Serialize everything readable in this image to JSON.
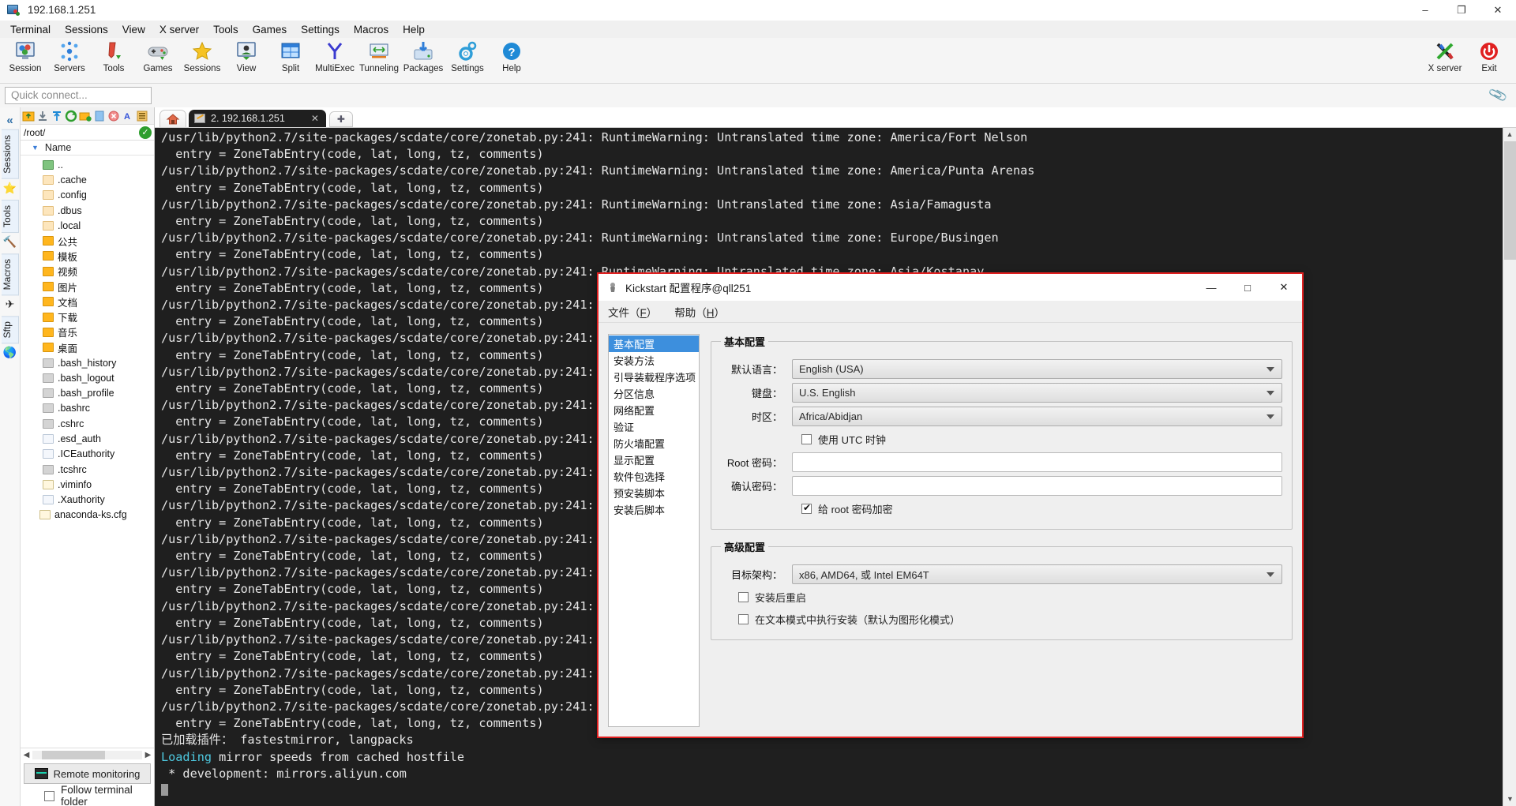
{
  "window": {
    "title": "192.168.1.251",
    "icon": "mobaxterm-icon",
    "minimize": "–",
    "maximize": "❐",
    "close": "✕"
  },
  "menubar": [
    "Terminal",
    "Sessions",
    "View",
    "X server",
    "Tools",
    "Games",
    "Settings",
    "Macros",
    "Help"
  ],
  "toolbar": {
    "items": [
      {
        "label": "Session",
        "icon": "session-icon"
      },
      {
        "label": "Servers",
        "icon": "servers-icon"
      },
      {
        "label": "Tools",
        "icon": "tools-icon"
      },
      {
        "label": "Games",
        "icon": "games-icon"
      },
      {
        "label": "Sessions",
        "icon": "star-icon"
      },
      {
        "label": "View",
        "icon": "view-icon"
      },
      {
        "label": "Split",
        "icon": "split-icon"
      },
      {
        "label": "MultiExec",
        "icon": "multiexec-icon"
      },
      {
        "label": "Tunneling",
        "icon": "tunneling-icon"
      },
      {
        "label": "Packages",
        "icon": "packages-icon"
      },
      {
        "label": "Settings",
        "icon": "settings-gear-icon"
      },
      {
        "label": "Help",
        "icon": "help-icon"
      }
    ],
    "right": [
      {
        "label": "X server",
        "icon": "x-server-icon"
      },
      {
        "label": "Exit",
        "icon": "power-icon"
      }
    ]
  },
  "quick_connect": {
    "placeholder": "Quick connect...",
    "value": ""
  },
  "sidebar": {
    "collapse": "«",
    "vtabs": [
      "Sessions",
      "Tools",
      "Macros",
      "Sftp"
    ],
    "path": "/root/",
    "tree_header": "Name",
    "items": [
      {
        "name": "..",
        "type": "up"
      },
      {
        "name": ".cache",
        "type": "folder-light"
      },
      {
        "name": ".config",
        "type": "folder-light"
      },
      {
        "name": ".dbus",
        "type": "folder-light"
      },
      {
        "name": ".local",
        "type": "folder-light"
      },
      {
        "name": "公共",
        "type": "folder"
      },
      {
        "name": "模板",
        "type": "folder"
      },
      {
        "name": "视频",
        "type": "folder"
      },
      {
        "name": "图片",
        "type": "folder"
      },
      {
        "name": "文档",
        "type": "folder"
      },
      {
        "name": "下载",
        "type": "folder"
      },
      {
        "name": "音乐",
        "type": "folder"
      },
      {
        "name": "桌面",
        "type": "folder"
      },
      {
        "name": ".bash_history",
        "type": "terminal"
      },
      {
        "name": ".bash_logout",
        "type": "terminal"
      },
      {
        "name": ".bash_profile",
        "type": "terminal"
      },
      {
        "name": ".bashrc",
        "type": "terminal"
      },
      {
        "name": ".cshrc",
        "type": "terminal"
      },
      {
        "name": ".esd_auth",
        "type": "plain"
      },
      {
        "name": ".ICEauthority",
        "type": "plain"
      },
      {
        "name": ".tcshrc",
        "type": "terminal"
      },
      {
        "name": ".viminfo",
        "type": "edit"
      },
      {
        "name": ".Xauthority",
        "type": "plain"
      },
      {
        "name": "anaconda-ks.cfg",
        "type": "edit"
      }
    ],
    "remote_monitoring": "Remote monitoring",
    "follow_terminal_folder": "Follow terminal folder",
    "follow_checked": false
  },
  "tabbar": {
    "home_icon": "home-icon",
    "tab_label": "2. 192.168.1.251",
    "tab_close": "✕",
    "add_tab": "✚"
  },
  "terminal": {
    "lines": [
      {
        "text": "/usr/lib/python2.7/site-packages/scdate/core/zonetab.py:241: RuntimeWarning: Untranslated time zone: America/Fort Nelson"
      },
      {
        "text": "  entry = ZoneTabEntry(code, lat, long, tz, comments)"
      },
      {
        "text": "/usr/lib/python2.7/site-packages/scdate/core/zonetab.py:241: RuntimeWarning: Untranslated time zone: America/Punta Arenas"
      },
      {
        "text": "  entry = ZoneTabEntry(code, lat, long, tz, comments)"
      },
      {
        "text": "/usr/lib/python2.7/site-packages/scdate/core/zonetab.py:241: RuntimeWarning: Untranslated time zone: Asia/Famagusta"
      },
      {
        "text": "  entry = ZoneTabEntry(code, lat, long, tz, comments)"
      },
      {
        "text": "/usr/lib/python2.7/site-packages/scdate/core/zonetab.py:241: RuntimeWarning: Untranslated time zone: Europe/Busingen"
      },
      {
        "text": "  entry = ZoneTabEntry(code, lat, long, tz, comments)"
      },
      {
        "text": "/usr/lib/python2.7/site-packages/scdate/core/zonetab.py:241: RuntimeWarning: Untranslated time zone: Asia/Kostanay"
      },
      {
        "text": "  entry = ZoneTabEntry(code, lat, long, tz, comments)"
      },
      {
        "text": "/usr/lib/python2.7/site-packages/scdate/core/zonetab.py:241: RuntimeWarning: Untranslated time zone: Asia/Atyrau"
      },
      {
        "text": "  entry = ZoneTabEntry(code, lat, long, tz, comments)"
      },
      {
        "text": "/usr/lib/python2.7/site-packages/scdate/core/zonetab.py:241: RuntimeWarning: Untranslated time zone: Asia/Yangon"
      },
      {
        "text": "  entry = ZoneTabEntry(code, lat, long, tz, comments)"
      },
      {
        "text": "/usr/lib/python2.7/site-packages/scdate/core/zonetab.py:241: RuntimeWarning: Untranslated time zone: Pacific/Bougainville"
      },
      {
        "text": "  entry = ZoneTabEntry(code, lat, long, tz, comments)"
      },
      {
        "text": "/usr/lib/python2.7/site-packages/scdate/core/zonetab.py:241: RuntimeWarning: Untranslated time zone: Europe/Kirov"
      },
      {
        "text": "  entry = ZoneTabEntry(code, lat, long, tz, comments)"
      },
      {
        "text": "/usr/lib/python2.7/site-packages/scdate/core/zonetab.py:241: RuntimeWarning: Untranslated time zone: Europe/Astrakhan"
      },
      {
        "text": "  entry = ZoneTabEntry(code, lat, long, tz, comments)"
      },
      {
        "text": "/usr/lib/python2.7/site-packages/scdate/core/zonetab.py:241: RuntimeWarning: Untranslated time zone: Europe/Saratov"
      },
      {
        "text": "  entry = ZoneTabEntry(code, lat, long, tz, comments)"
      },
      {
        "text": "/usr/lib/python2.7/site-packages/scdate/core/zonetab.py:241: RuntimeWarning: Untranslated time zone: Europe/Ulyanovsk"
      },
      {
        "text": "  entry = ZoneTabEntry(code, lat, long, tz, comments)"
      },
      {
        "text": "/usr/lib/python2.7/site-packages/scdate/core/zonetab.py:241: RuntimeWarning: Untranslated time zone: Asia/Barnaul"
      },
      {
        "text": "  entry = ZoneTabEntry(code, lat, long, tz, comments)"
      },
      {
        "text": "/usr/lib/python2.7/site-packages/scdate/core/zonetab.py:241: RuntimeWarning: Untranslated time zone: Asia/Tomsk"
      },
      {
        "text": "  entry = ZoneTabEntry(code, lat, long, tz, comments)"
      },
      {
        "text": "/usr/lib/python2.7/site-packages/scdate/core/zonetab.py:241: RuntimeWarning: Untranslated time zone: Asia/Chita"
      },
      {
        "text": "  entry = ZoneTabEntry(code, lat, long, tz, comments)"
      },
      {
        "text": "/usr/lib/python2.7/site-packages/scdate/core/zonetab.py:241: RuntimeWarning: Untranslated time zone: Asia/Khandyga"
      },
      {
        "text": "  entry = ZoneTabEntry(code, lat, long, tz, comments)"
      },
      {
        "text": "/usr/lib/python2.7/site-packages/scdate/core/zonetab.py:241: RuntimeWarning: Untranslated time zone: Asia/Ust-Nera"
      },
      {
        "text": "  entry = ZoneTabEntry(code, lat, long, tz, comments)"
      },
      {
        "text": "/usr/lib/python2.7/site-packages/scdate/core/zonetab.py:241: RuntimeWarning: Untranslated time zone: Asia/Srednekolymsk"
      },
      {
        "text": "  entry = ZoneTabEntry(code, lat, long, tz, comments)"
      },
      {
        "text": "已加载插件： fastestmirror, langpacks"
      },
      {
        "text": "Loading mirror speeds from cached hostfile",
        "highlight": "Loading"
      },
      {
        "text": " * development: mirrors.aliyun.com"
      }
    ]
  },
  "dialog": {
    "title": "Kickstart 配置程序@qll251",
    "icon": "kickstart-icon",
    "minimize": "—",
    "maximize": "□",
    "close": "✕",
    "menu": [
      {
        "label": "文件（",
        "mnemonic": "F",
        "tail": "）"
      },
      {
        "label": "帮助（",
        "mnemonic": "H",
        "tail": "）"
      }
    ],
    "nav": [
      "基本配置",
      "安装方法",
      "引导装载程序选项",
      "分区信息",
      "网络配置",
      "验证",
      "防火墙配置",
      "显示配置",
      "软件包选择",
      "预安装脚本",
      "安装后脚本"
    ],
    "nav_selected_index": 0,
    "basic": {
      "legend": "基本配置",
      "language_label": "默认语言：",
      "language_value": "English (USA)",
      "keyboard_label": "键盘：",
      "keyboard_value": "U.S. English",
      "timezone_label": "时区：",
      "timezone_value": "Africa/Abidjan",
      "utc_label": "使用 UTC 时钟",
      "utc_checked": false,
      "root_pw_label": "Root 密码：",
      "root_pw_value": "",
      "confirm_pw_label": "确认密码：",
      "confirm_pw_value": "",
      "encrypt_label": "给 root 密码加密",
      "encrypt_checked": true
    },
    "advanced": {
      "legend": "高级配置",
      "arch_label": "目标架构：",
      "arch_value": "x86, AMD64, 或 Intel EM64T",
      "reboot_label": "安装后重启",
      "reboot_checked": false,
      "textmode_label": "在文本模式中执行安装（默认为图形化模式）",
      "textmode_checked": false
    },
    "border_color": "#e02020"
  },
  "colors": {
    "accent": "#3d8fdd",
    "terminal_bg": "#1f1f1f",
    "terminal_fg": "#e6e6e6",
    "terminal_cyan": "#4ec9e0",
    "dialog_border": "#e02020"
  }
}
